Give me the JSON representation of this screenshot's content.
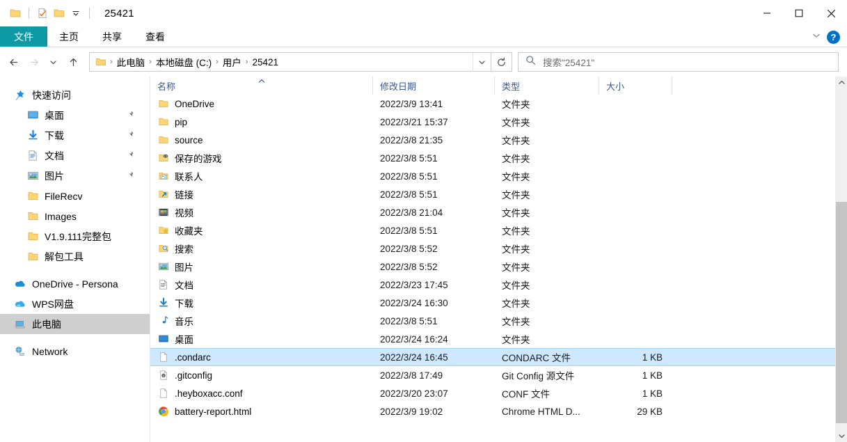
{
  "window": {
    "title": "25421",
    "quick_access": [
      {
        "name": "folder-icon",
        "label": "保存"
      },
      {
        "name": "properties-icon",
        "label": "属性"
      },
      {
        "name": "new-folder-icon",
        "label": "新建文件夹"
      },
      {
        "name": "chevron-down-icon",
        "label": "自定义快速访问工具栏"
      }
    ],
    "controls": {
      "minimize": "—",
      "maximize": "□",
      "close": "✕"
    }
  },
  "ribbon": {
    "tabs": [
      {
        "label": "文件",
        "active": true
      },
      {
        "label": "主页",
        "active": false
      },
      {
        "label": "共享",
        "active": false
      },
      {
        "label": "查看",
        "active": false
      }
    ],
    "expand_label": "展开功能区",
    "help_label": "?"
  },
  "nav": {
    "back_label": "后退",
    "forward_label": "前进",
    "recent_label": "最近浏览的位置",
    "up_label": "上移一级",
    "refresh_label": "刷新",
    "breadcrumbs": [
      "此电脑",
      "本地磁盘 (C:)",
      "用户",
      "25421"
    ],
    "separator": "›"
  },
  "search": {
    "placeholder": "搜索\"25421\"",
    "icon": "search-icon"
  },
  "sidebar": {
    "groups": [
      {
        "header": {
          "label": "快速访问",
          "icon": "star-pin-icon"
        },
        "items": [
          {
            "label": "桌面",
            "icon": "desktop-icon",
            "pinned": true
          },
          {
            "label": "下载",
            "icon": "download-icon",
            "pinned": true
          },
          {
            "label": "文档",
            "icon": "documents-icon",
            "pinned": true
          },
          {
            "label": "图片",
            "icon": "pictures-icon",
            "pinned": true
          },
          {
            "label": "FileRecv",
            "icon": "folder-icon",
            "pinned": false
          },
          {
            "label": "Images",
            "icon": "folder-icon",
            "pinned": false
          },
          {
            "label": "V1.9.111完整包",
            "icon": "folder-icon",
            "pinned": false
          },
          {
            "label": "解包工具",
            "icon": "folder-icon",
            "pinned": false
          }
        ]
      },
      {
        "header": null,
        "items": [
          {
            "label": "OneDrive - Persona",
            "icon": "onedrive-icon",
            "pinned": false
          },
          {
            "label": "WPS网盘",
            "icon": "wps-cloud-icon",
            "pinned": false
          },
          {
            "label": "此电脑",
            "icon": "this-pc-icon",
            "pinned": false,
            "selected": true
          },
          {
            "label": "Network",
            "icon": "network-icon",
            "pinned": false
          }
        ]
      }
    ]
  },
  "file_list": {
    "columns": [
      {
        "label": "名称",
        "sorted": "asc"
      },
      {
        "label": "修改日期",
        "sorted": null
      },
      {
        "label": "类型",
        "sorted": null
      },
      {
        "label": "大小",
        "sorted": null
      }
    ],
    "rows": [
      {
        "name": "OneDrive",
        "date": "2022/3/9 13:41",
        "type": "文件夹",
        "size": "",
        "icon": "folder-icon",
        "selected": false
      },
      {
        "name": "pip",
        "date": "2022/3/21 15:37",
        "type": "文件夹",
        "size": "",
        "icon": "folder-icon",
        "selected": false
      },
      {
        "name": "source",
        "date": "2022/3/8 21:35",
        "type": "文件夹",
        "size": "",
        "icon": "folder-icon",
        "selected": false
      },
      {
        "name": "保存的游戏",
        "date": "2022/3/8 5:51",
        "type": "文件夹",
        "size": "",
        "icon": "saved-games-icon",
        "selected": false
      },
      {
        "name": "联系人",
        "date": "2022/3/8 5:51",
        "type": "文件夹",
        "size": "",
        "icon": "contacts-icon",
        "selected": false
      },
      {
        "name": "链接",
        "date": "2022/3/8 5:51",
        "type": "文件夹",
        "size": "",
        "icon": "links-icon",
        "selected": false
      },
      {
        "name": "视频",
        "date": "2022/3/8 21:04",
        "type": "文件夹",
        "size": "",
        "icon": "videos-icon",
        "selected": false
      },
      {
        "name": "收藏夹",
        "date": "2022/3/8 5:51",
        "type": "文件夹",
        "size": "",
        "icon": "favorites-icon",
        "selected": false
      },
      {
        "name": "搜索",
        "date": "2022/3/8 5:52",
        "type": "文件夹",
        "size": "",
        "icon": "searches-icon",
        "selected": false
      },
      {
        "name": "图片",
        "date": "2022/3/8 5:52",
        "type": "文件夹",
        "size": "",
        "icon": "pictures-icon",
        "selected": false
      },
      {
        "name": "文档",
        "date": "2022/3/23 17:45",
        "type": "文件夹",
        "size": "",
        "icon": "documents-icon",
        "selected": false
      },
      {
        "name": "下载",
        "date": "2022/3/24 16:30",
        "type": "文件夹",
        "size": "",
        "icon": "download-icon",
        "selected": false
      },
      {
        "name": "音乐",
        "date": "2022/3/8 5:51",
        "type": "文件夹",
        "size": "",
        "icon": "music-icon",
        "selected": false
      },
      {
        "name": "桌面",
        "date": "2022/3/24 16:24",
        "type": "文件夹",
        "size": "",
        "icon": "desktop-icon",
        "selected": false
      },
      {
        "name": ".condarc",
        "date": "2022/3/24 16:45",
        "type": "CONDARC 文件",
        "size": "1 KB",
        "icon": "blank-file-icon",
        "selected": true
      },
      {
        "name": ".gitconfig",
        "date": "2022/3/8 17:49",
        "type": "Git Config 源文件",
        "size": "1 KB",
        "icon": "gear-file-icon",
        "selected": false
      },
      {
        "name": ".heyboxacc.conf",
        "date": "2022/3/20 23:07",
        "type": "CONF 文件",
        "size": "1 KB",
        "icon": "blank-file-icon",
        "selected": false
      },
      {
        "name": "battery-report.html",
        "date": "2022/3/9 19:02",
        "type": "Chrome HTML D...",
        "size": "29 KB",
        "icon": "chrome-icon",
        "selected": false
      }
    ]
  },
  "scrollbar": {
    "up_label": "向上滚动",
    "down_label": "向下滚动"
  },
  "colors": {
    "file_tab": "#0d9aa4",
    "selection": "#cde8ff",
    "sidebar_selection": "#cfcfcf",
    "folder_yellow": "#fcd675",
    "help_blue": "#0072c6",
    "column_header_text": "#3a5a8c"
  }
}
